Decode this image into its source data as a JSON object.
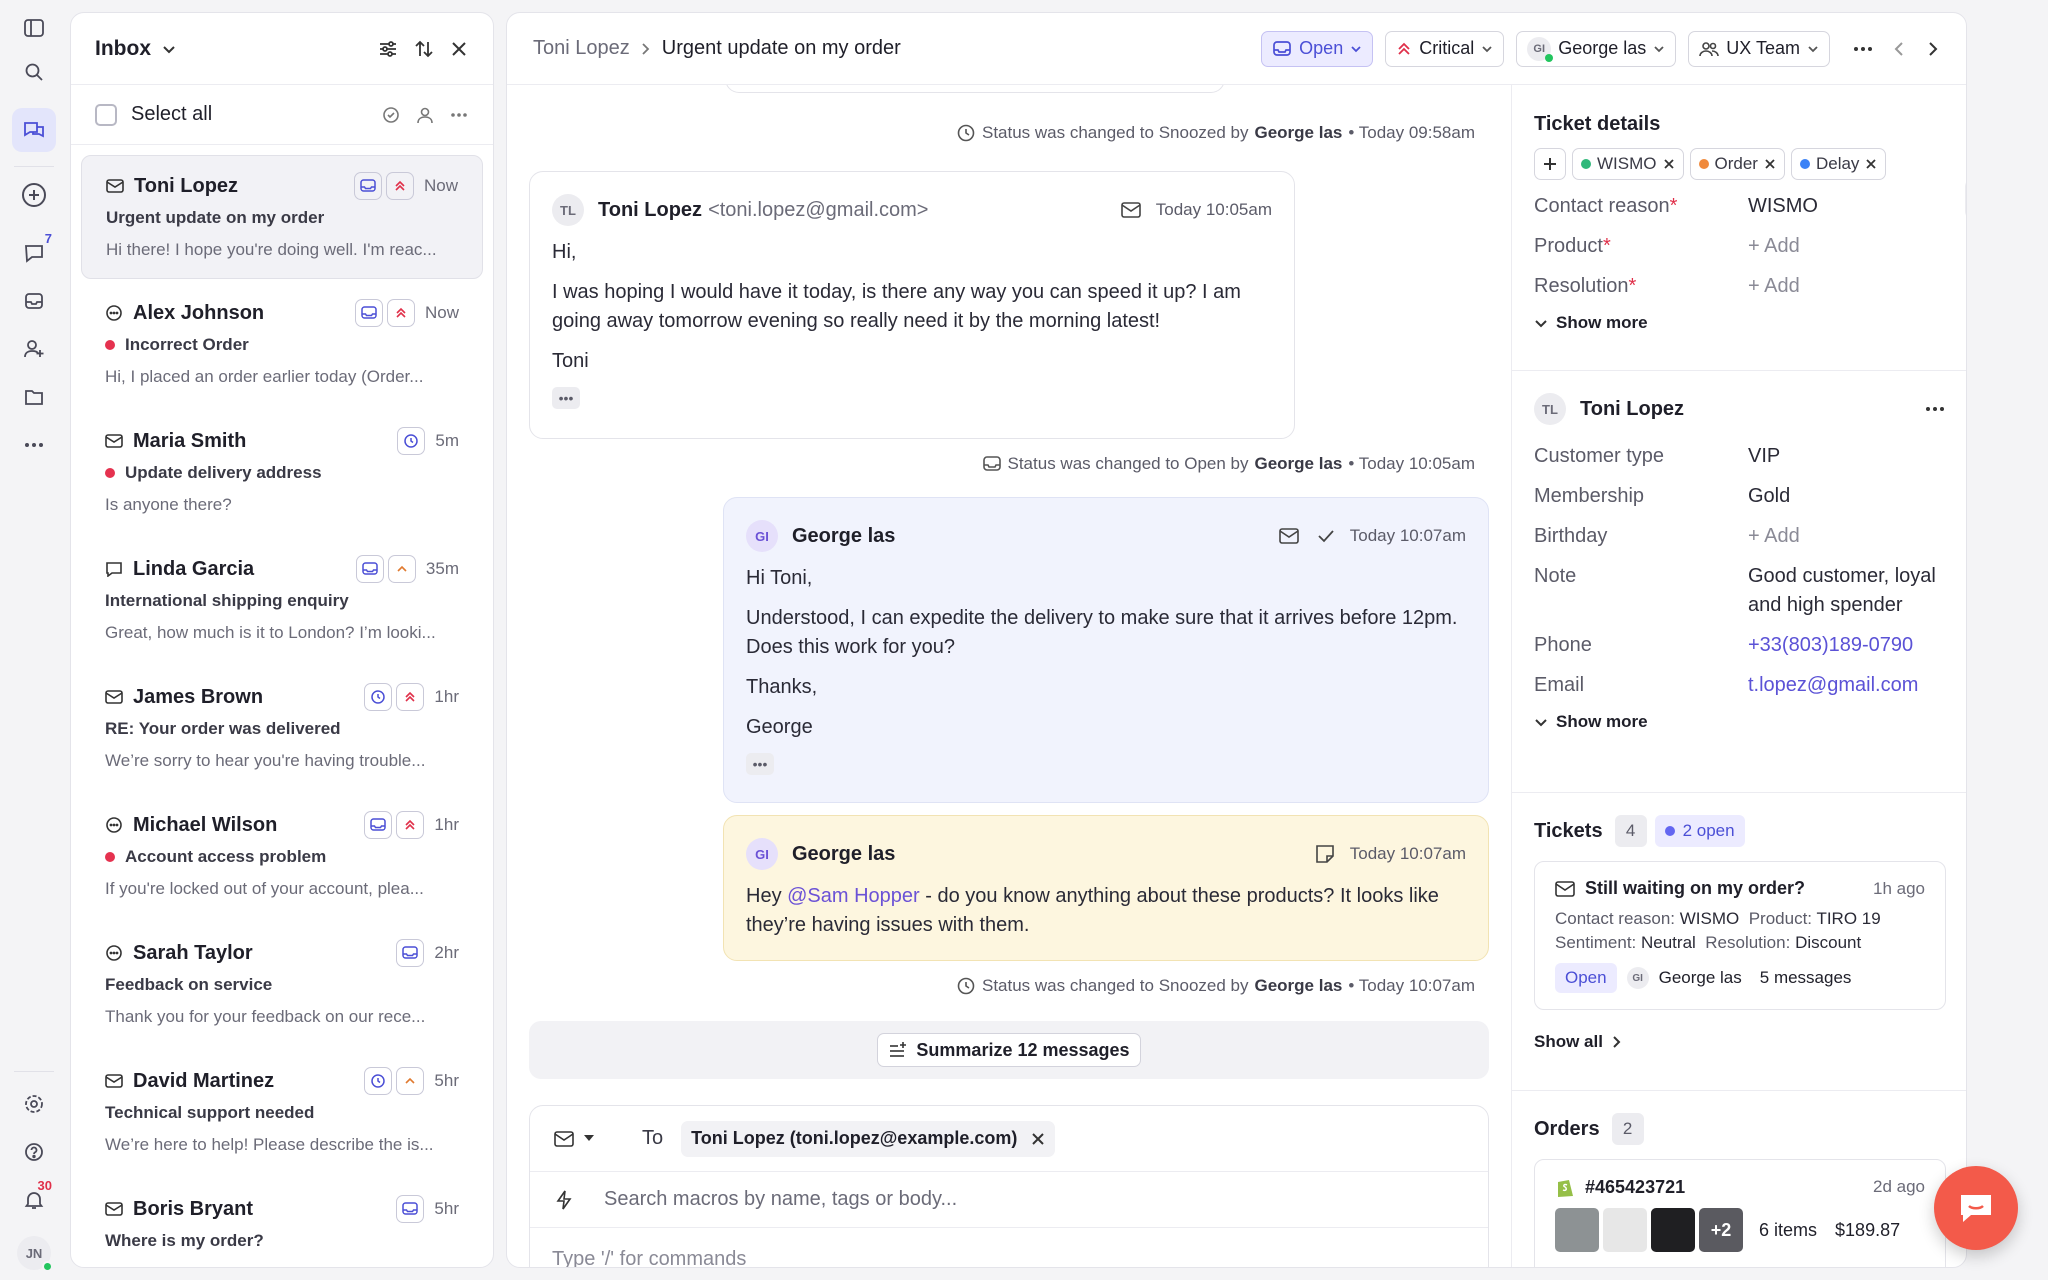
{
  "rail": {
    "inbox_badge": "7",
    "notif_badge": "30",
    "user_initials": "JN"
  },
  "inbox": {
    "title": "Inbox",
    "select_all": "Select all",
    "tickets": [
      {
        "name": "Toni Lopez",
        "time": "Now",
        "subject": "Urgent update on my order",
        "preview": "Hi there! I hope you're doing well. I'm reac...",
        "type": "email",
        "unread": false
      },
      {
        "name": "Alex Johnson",
        "time": "Now",
        "subject": "Incorrect Order",
        "preview": "Hi, I placed an order earlier today (Order...",
        "type": "chat",
        "unread": true
      },
      {
        "name": "Maria Smith",
        "time": "5m",
        "subject": "Update delivery address",
        "preview": "Is anyone there?",
        "type": "email",
        "unread": true
      },
      {
        "name": "Linda Garcia",
        "time": "35m",
        "subject": "International shipping enquiry",
        "preview": "Great, how much is it to London? I’m looki...",
        "type": "sms",
        "unread": false
      },
      {
        "name": "James Brown",
        "time": "1hr",
        "subject": "RE: Your order was delivered",
        "preview": "We’re sorry to hear you're having trouble...",
        "type": "email",
        "unread": false
      },
      {
        "name": "Michael Wilson",
        "time": "1hr",
        "subject": "Account access problem",
        "preview": "If you're locked out of your account, plea...",
        "type": "chat",
        "unread": true
      },
      {
        "name": "Sarah Taylor",
        "time": "2hr",
        "subject": "Feedback on service",
        "preview": "Thank you for your feedback on our rece...",
        "type": "chat",
        "unread": false
      },
      {
        "name": "David Martinez",
        "time": "5hr",
        "subject": "Technical support needed",
        "preview": "We’re here to help! Please describe the is...",
        "type": "email",
        "unread": false
      },
      {
        "name": "Boris Bryant",
        "time": "5hr",
        "subject": "Where is my order?",
        "preview": "",
        "type": "email",
        "unread": false
      }
    ]
  },
  "header": {
    "crumb_customer": "Toni Lopez",
    "crumb_ticket": "Urgent update on my order",
    "status": "Open",
    "priority": "Critical",
    "assignee": "George las",
    "assignee_initials": "GI",
    "team": "UX Team"
  },
  "conversation": {
    "sys1": {
      "text": "Status was changed to Snoozed by",
      "who": "George las",
      "when": "• Today 09:58am"
    },
    "msg1": {
      "initials": "TL",
      "name": "Toni Lopez",
      "email": "<toni.lopez@gmail.com>",
      "time": "Today 10:05am",
      "l1": "Hi,",
      "l2": "I was hoping I would have it today, is there any way you can speed it up? I am going away tomorrow evening so really need it by the morning latest!",
      "l3": "Toni"
    },
    "sys2": {
      "text": "Status was changed to Open by",
      "who": "George las",
      "when": "• Today 10:05am"
    },
    "msg2": {
      "initials": "GI",
      "name": "George las",
      "time": "Today 10:07am",
      "l1": "Hi Toni,",
      "l2": "Understood, I can expedite the delivery to make sure that it arrives before 12pm. Does this work for you?",
      "l3": "Thanks,",
      "l4": "George"
    },
    "note": {
      "initials": "GI",
      "name": "George las",
      "time": "Today 10:07am",
      "pre": "Hey ",
      "mention": "@Sam Hopper",
      "post": " - do you know anything about these products? It looks like they’re having issues with them."
    },
    "sys3": {
      "text": "Status was changed to Snoozed by",
      "who": "George las",
      "when": "• Today 10:07am"
    },
    "summarize": "Summarize 12 messages"
  },
  "composer": {
    "to_label": "To",
    "recipient": "Toni Lopez (toni.lopez@example.com)",
    "macro_placeholder": "Search macros by name, tags or body...",
    "body_placeholder": "Type '/' for commands"
  },
  "details": {
    "title": "Ticket details",
    "tags": [
      {
        "label": "WISMO",
        "color": "#2fb87a"
      },
      {
        "label": "Order",
        "color": "#f08a3c"
      },
      {
        "label": "Delay",
        "color": "#3b82f6"
      }
    ],
    "contact_reason_label": "Contact reason",
    "contact_reason": "WISMO",
    "product_label": "Product",
    "product": "+ Add",
    "resolution_label": "Resolution",
    "resolution": "+ Add",
    "show_more": "Show more",
    "customer": {
      "initials": "TL",
      "name": "Toni Lopez",
      "type_label": "Customer type",
      "type": "VIP",
      "membership_label": "Membership",
      "membership": "Gold",
      "birthday_label": "Birthday",
      "birthday": "+ Add",
      "note_label": "Note",
      "note": "Good customer, loyal and high spender",
      "phone_label": "Phone",
      "phone": "+33(803)189-0790",
      "email_label": "Email",
      "email": "t.lopez@gmail.com",
      "show_more": "Show more"
    },
    "tickets": {
      "title": "Tickets",
      "count": "4",
      "open": "2 open",
      "card": {
        "subject": "Still waiting on my order?",
        "time": "1h ago",
        "cr_label": "Contact reason:",
        "cr": "WISMO",
        "prod_label": "Product:",
        "prod": "TIRO 19",
        "sent_label": "Sentiment:",
        "sent": "Neutral",
        "res_label": "Resolution:",
        "res": "Discount",
        "status": "Open",
        "assignee": "George las",
        "messages": "5 messages"
      },
      "show_all": "Show all"
    },
    "orders": {
      "title": "Orders",
      "count": "2",
      "id": "#465423721",
      "time": "2d ago",
      "extra": "+2",
      "items": "6 items",
      "total": "$189.87"
    }
  }
}
